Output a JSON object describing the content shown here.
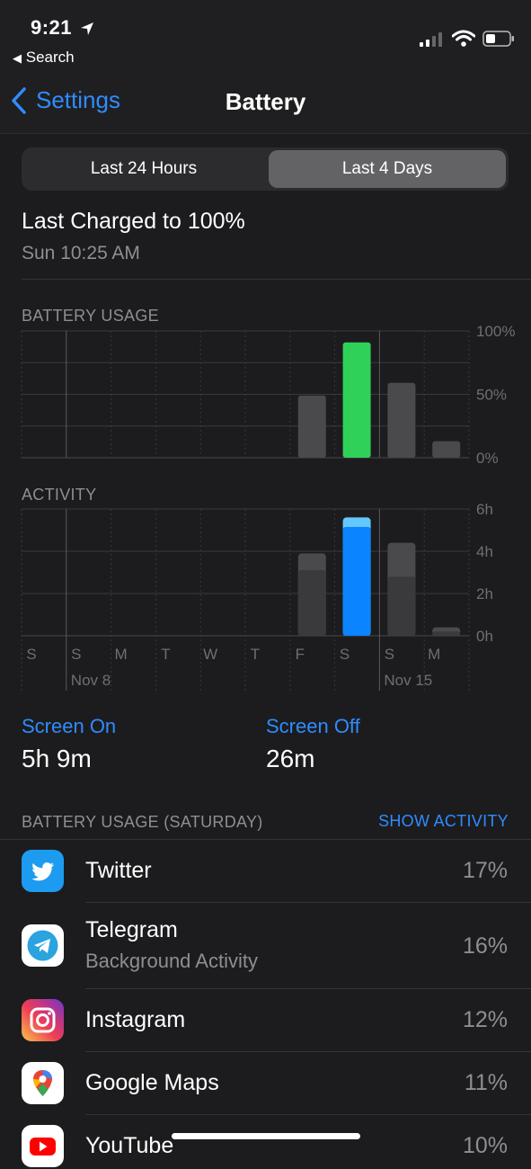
{
  "status": {
    "time": "9:21",
    "back_app": "Search"
  },
  "nav": {
    "back_label": "Settings",
    "title": "Battery"
  },
  "segments": [
    "Last 24 Hours",
    "Last 4 Days"
  ],
  "last_charged": {
    "title": "Last Charged to 100%",
    "time": "Sun 10:25 AM"
  },
  "colors": {
    "accent": "#2f8cff",
    "battery_green": "#30d158",
    "activity_blue": "#0a84ff",
    "activity_light_blue": "#64c8ff",
    "bar_gray": "#4a4a4c"
  },
  "chart_data": [
    {
      "type": "bar",
      "title": "BATTERY USAGE",
      "categories": [
        "S",
        "S",
        "M",
        "T",
        "W",
        "T",
        "F",
        "S",
        "S",
        "M"
      ],
      "values": [
        0,
        0,
        0,
        0,
        0,
        0,
        49,
        91,
        59,
        13
      ],
      "highlight_index": 7,
      "ylim": [
        0,
        100
      ],
      "yticks": [
        "100%",
        "50%",
        "0%"
      ]
    },
    {
      "type": "bar",
      "title": "ACTIVITY",
      "categories": [
        "S",
        "S",
        "M",
        "T",
        "W",
        "T",
        "F",
        "S",
        "S",
        "M"
      ],
      "series": [
        {
          "name": "Screen On",
          "values": [
            0,
            0,
            0,
            0,
            0,
            0,
            3.1,
            5.15,
            2.8,
            0.2
          ]
        },
        {
          "name": "Screen Off",
          "values": [
            0,
            0,
            0,
            0,
            0,
            0,
            0.8,
            0.45,
            1.6,
            0.2
          ]
        }
      ],
      "highlight_index": 7,
      "ylim": [
        0,
        6
      ],
      "yticks": [
        "6h",
        "4h",
        "2h",
        "0h"
      ],
      "date_labels": [
        "Nov 8",
        "Nov 15"
      ]
    }
  ],
  "screen_time": {
    "on_label": "Screen On",
    "on_value": "5h 9m",
    "off_label": "Screen Off",
    "off_value": "26m"
  },
  "usage": {
    "header": "BATTERY USAGE (SATURDAY)",
    "action": "SHOW ACTIVITY",
    "apps": [
      {
        "name": "Twitter",
        "subtitle": "",
        "percent": "17%",
        "icon": "twitter-icon"
      },
      {
        "name": "Telegram",
        "subtitle": "Background Activity",
        "percent": "16%",
        "icon": "telegram-icon"
      },
      {
        "name": "Instagram",
        "subtitle": "",
        "percent": "12%",
        "icon": "instagram-icon"
      },
      {
        "name": "Google Maps",
        "subtitle": "",
        "percent": "11%",
        "icon": "google-maps-icon"
      },
      {
        "name": "YouTube",
        "subtitle": "",
        "percent": "10%",
        "icon": "youtube-icon"
      }
    ]
  }
}
